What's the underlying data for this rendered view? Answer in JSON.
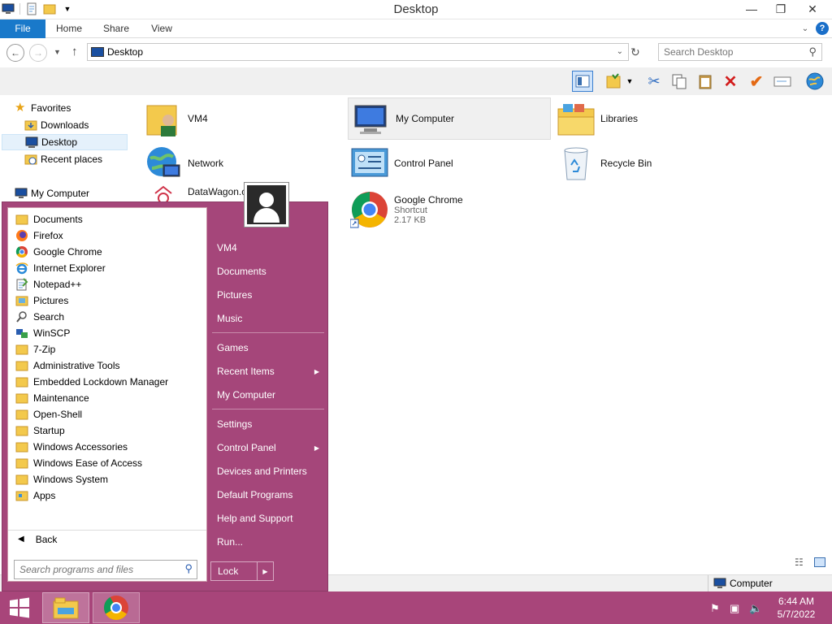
{
  "window": {
    "title": "Desktop",
    "controls": {
      "minimize": "—",
      "maximize": "❐",
      "close": "✕"
    }
  },
  "ribbon": {
    "tabs": [
      {
        "label": "File"
      },
      {
        "label": "Home"
      },
      {
        "label": "Share"
      },
      {
        "label": "View"
      }
    ],
    "help": "?"
  },
  "address": {
    "path": "Desktop",
    "search_placeholder": "Search Desktop"
  },
  "nav_pane": {
    "items": [
      {
        "label": "Favorites",
        "icon": "star-icon"
      },
      {
        "label": "Downloads",
        "icon": "downloads-folder-icon"
      },
      {
        "label": "Desktop",
        "icon": "desktop-icon"
      },
      {
        "label": "Recent places",
        "icon": "recent-places-icon"
      },
      {
        "label": "My Computer",
        "icon": "computer-icon"
      }
    ]
  },
  "content": {
    "items": [
      {
        "label": "VM4",
        "icon": "user-folder-icon"
      },
      {
        "label": "My Computer",
        "icon": "computer-icon"
      },
      {
        "label": "Libraries",
        "icon": "libraries-icon"
      },
      {
        "label": "Network",
        "icon": "network-icon"
      },
      {
        "label": "Control Panel",
        "icon": "control-panel-icon"
      },
      {
        "label": "Recycle Bin",
        "icon": "recycle-bin-icon"
      },
      {
        "label": "DataWagon.c",
        "icon": "datawagon-icon"
      },
      {
        "label": "Google Chrome",
        "sub1": "Shortcut",
        "sub2": "2.17 KB",
        "icon": "chrome-icon"
      }
    ]
  },
  "statusbar": {
    "location": "Computer"
  },
  "start_menu": {
    "programs": [
      {
        "label": "Documents",
        "icon": "folder-icon"
      },
      {
        "label": "Firefox",
        "icon": "firefox-icon"
      },
      {
        "label": "Google Chrome",
        "icon": "chrome-icon"
      },
      {
        "label": "Internet Explorer",
        "icon": "ie-icon"
      },
      {
        "label": "Notepad++",
        "icon": "notepad-icon"
      },
      {
        "label": "Pictures",
        "icon": "pictures-icon"
      },
      {
        "label": "Search",
        "icon": "search-icon"
      },
      {
        "label": "WinSCP",
        "icon": "winscp-icon"
      },
      {
        "label": "7-Zip",
        "icon": "folder-icon"
      },
      {
        "label": "Administrative Tools",
        "icon": "folder-icon"
      },
      {
        "label": "Embedded Lockdown Manager",
        "icon": "folder-icon"
      },
      {
        "label": "Maintenance",
        "icon": "folder-icon"
      },
      {
        "label": "Open-Shell",
        "icon": "folder-icon"
      },
      {
        "label": "Startup",
        "icon": "folder-icon"
      },
      {
        "label": "Windows Accessories",
        "icon": "folder-icon"
      },
      {
        "label": "Windows Ease of Access",
        "icon": "folder-icon"
      },
      {
        "label": "Windows System",
        "icon": "folder-icon"
      },
      {
        "label": "Apps",
        "icon": "apps-folder-icon"
      }
    ],
    "back_label": "Back",
    "search_placeholder": "Search programs and files",
    "right": [
      {
        "label": "VM4"
      },
      {
        "label": "Documents"
      },
      {
        "label": "Pictures"
      },
      {
        "label": "Music"
      },
      {
        "label": "Games"
      },
      {
        "label": "Recent Items",
        "submenu": true
      },
      {
        "label": "My Computer"
      },
      {
        "label": "Settings"
      },
      {
        "label": "Control Panel",
        "submenu": true
      },
      {
        "label": "Devices and Printers"
      },
      {
        "label": "Default Programs"
      },
      {
        "label": "Help and Support"
      },
      {
        "label": "Run..."
      }
    ],
    "lock_label": "Lock"
  },
  "taskbar": {
    "time": "6:44 AM",
    "date": "5/7/2022"
  },
  "colors": {
    "accent": "#a5467a",
    "file_tab": "#1979ca"
  }
}
